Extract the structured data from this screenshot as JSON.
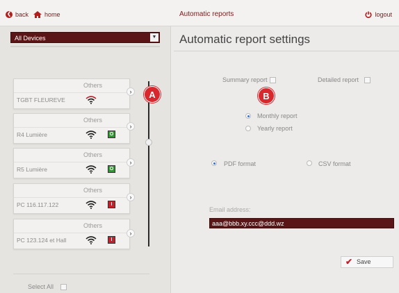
{
  "nav": {
    "back_label": "back",
    "home_label": "home",
    "title": "Automatic reports",
    "logout_label": "logout"
  },
  "device_filter": {
    "selected": "All Devices"
  },
  "devices": [
    {
      "category": "Others",
      "name": "TGBT FLEUREVE",
      "status": null
    },
    {
      "category": "Others",
      "name": "R4 Lumière",
      "status": "O"
    },
    {
      "category": "Others",
      "name": "R5 Lumière",
      "status": "O"
    },
    {
      "category": "Others",
      "name": "PC 116.117.122",
      "status": "I"
    },
    {
      "category": "Others",
      "name": "PC 123.124 et Hall",
      "status": "I"
    }
  ],
  "select_all_label": "Select All",
  "markers": {
    "a": "A",
    "b": "B"
  },
  "settings": {
    "title": "Automatic report settings",
    "summary_label": "Summary report",
    "detailed_label": "Detailed report",
    "monthly_label": "Monthly report",
    "yearly_label": "Yearly report",
    "pdf_label": "PDF format",
    "csv_label": "CSV format",
    "email_label": "Email address:",
    "email_value": "aaa@bbb.xy.ccc@ddd.wz",
    "save_label": "Save"
  },
  "colors": {
    "accent": "#5a1616",
    "marker": "#d9272e",
    "status_ok": "#2a9a2a",
    "status_err": "#c4202c"
  }
}
